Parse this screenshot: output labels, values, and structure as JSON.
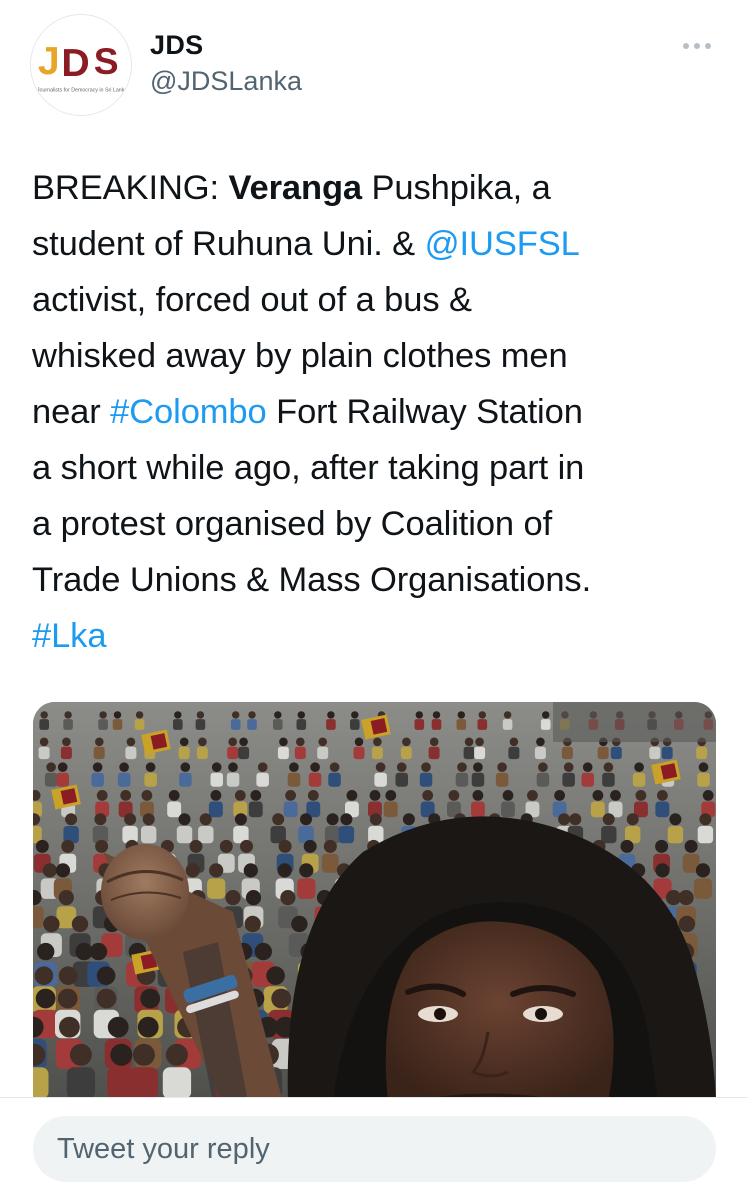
{
  "tweet": {
    "author_name": "JDS",
    "author_handle": "@JDSLanka",
    "avatar_logo": {
      "letters": "JDS",
      "tagline": "Journalists for Democracy in Sri Lanka"
    },
    "text_lines": [
      [
        {
          "t": "BREAKING: "
        },
        {
          "t": "Veranga",
          "bold": true
        },
        {
          "t": " Pushpika, a"
        }
      ],
      [
        {
          "t": "student of Ruhuna Uni. & "
        },
        {
          "t": "@IUSFSL",
          "link": true
        }
      ],
      [
        {
          "t": "activist, forced out of a bus &"
        }
      ],
      [
        {
          "t": "whisked away by plain clothes men"
        }
      ],
      [
        {
          "t": "near "
        },
        {
          "t": "#Colombo",
          "link": true
        },
        {
          "t": " Fort Railway Station"
        }
      ],
      [
        {
          "t": "a short while ago, after taking part in"
        }
      ],
      [
        {
          "t": "a protest organised by Coalition of"
        }
      ],
      [
        {
          "t": "Trade Unions & Mass Organisations."
        }
      ],
      [
        {
          "t": "#Lka",
          "link": true
        }
      ]
    ]
  },
  "reply": {
    "placeholder": "Tweet your reply"
  },
  "colors": {
    "link": "#1d9bf0",
    "secondary_text": "#536471",
    "reply_bg": "#eff3f4"
  },
  "icons": {
    "more": "more-options-icon"
  }
}
